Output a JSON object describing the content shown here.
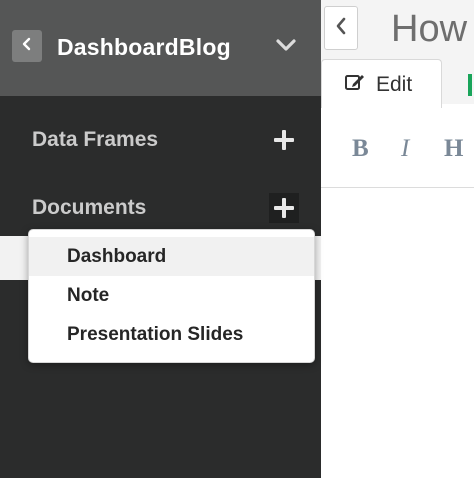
{
  "sidebar": {
    "app_title": "DashboardBlog",
    "sections": [
      {
        "label": "Data Frames"
      },
      {
        "label": "Documents"
      }
    ],
    "icons": {
      "back": "chevron-left-icon",
      "collapse": "chevron-down-icon",
      "add": "plus-icon"
    },
    "colors": {
      "header_bg": "#555656",
      "body_bg": "#2b2c2c"
    }
  },
  "dropdown": {
    "items": [
      {
        "label": "Dashboard",
        "highlighted": true
      },
      {
        "label": "Note"
      },
      {
        "label": "Presentation Slides"
      }
    ]
  },
  "editor": {
    "title": "How",
    "tabs": [
      {
        "label": "Edit",
        "icon": "edit-icon",
        "active": true
      }
    ],
    "toolbar": {
      "bold_label": "B",
      "italic_label": "I",
      "heading_label": "H"
    },
    "colors": {
      "accent_green": "#19a45a"
    }
  }
}
